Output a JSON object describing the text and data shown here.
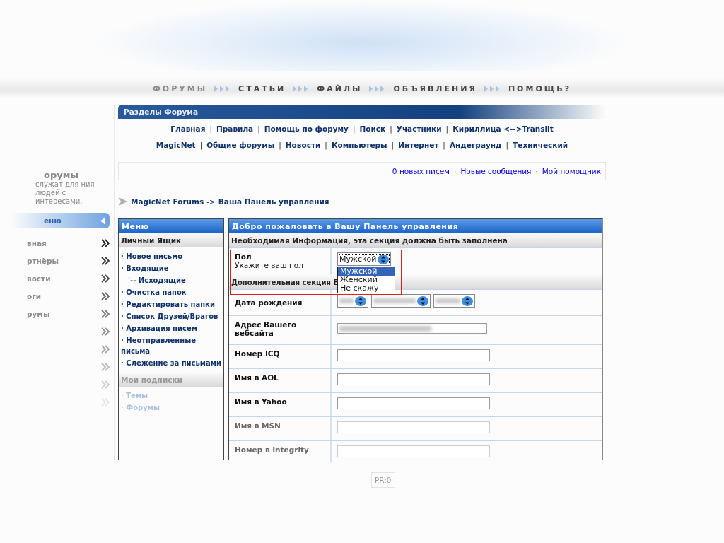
{
  "top_nav": [
    {
      "label": "ФОРУМЫ",
      "faded": true
    },
    {
      "label": "СТАТЬИ",
      "faded": false
    },
    {
      "label": "ФАЙЛЫ",
      "faded": false
    },
    {
      "label": "ОБЪЯВЛЕНИЯ",
      "faded": false
    },
    {
      "label": "ПОМОЩЬ?",
      "faded": false
    }
  ],
  "sidebar": {
    "title": "орумы",
    "description": "служат для ния людей с интересами.",
    "menu_button": "еню",
    "items": [
      {
        "label": "вная"
      },
      {
        "label": "ртнёры"
      },
      {
        "label": "вости"
      },
      {
        "label": "оги"
      },
      {
        "label": "румы"
      }
    ]
  },
  "forum_sections": {
    "title": "Разделы Форума",
    "separator": "|",
    "links_row_1": [
      "Главная",
      "Правила",
      "Помощь по форуму",
      "Поиск",
      "Участники",
      "Кириллица <-->Translit"
    ],
    "links_row_2": [
      "MagicNet",
      "Общие форумы",
      "Новости",
      "Компьютеры",
      "Интернет",
      "Андеграунд",
      "Технический"
    ]
  },
  "notifications": {
    "separator": "·",
    "links": [
      "0 новых писем",
      "Новые сообщения",
      "Мой помощник"
    ]
  },
  "breadcrumb": {
    "root": "MagicNet Forums",
    "separator": "->",
    "current": "Ваша Панель управления"
  },
  "menu": {
    "title": "Меню",
    "bullet": "·",
    "sections": [
      {
        "title": "Личный Ящик",
        "faded": false,
        "items": [
          {
            "label": "Новое письмо"
          },
          {
            "label": "Входящие",
            "children": [
              {
                "prefix": "'--",
                "label": "Исходящие"
              }
            ]
          },
          {
            "label": "Очистка папок"
          },
          {
            "label": "Редактировать папки"
          },
          {
            "label": "Список Друзей/Врагов"
          },
          {
            "label": "Архивация писем"
          },
          {
            "label": "Неотправленные письма"
          },
          {
            "label": "Слежение за письмами"
          }
        ]
      },
      {
        "title": "Мои подписки",
        "faded": true,
        "items": [
          {
            "label": "Темы"
          },
          {
            "label": "Форумы"
          }
        ]
      }
    ]
  },
  "panel": {
    "title": "Добро пожаловать в Вашу Панель управления",
    "required_section": "Необходимая Информация, эта секция должна быть заполнена",
    "gender": {
      "label": "Пол",
      "hint": "Укажите ваш пол",
      "value": "Мужской",
      "expanded": true,
      "options": [
        {
          "label": "Мужской",
          "selected": true
        },
        {
          "label": "Женский",
          "selected": false
        },
        {
          "label": "Не скажу",
          "selected": false
        }
      ]
    },
    "optional_section": "Дополнительная секция В",
    "fields": [
      {
        "label": "Дата рождения",
        "kind": "date",
        "faded": false
      },
      {
        "label": "Адрес Вашего вебсайта",
        "kind": "blurred",
        "faded": false
      },
      {
        "label": "Номер ICQ",
        "kind": "text",
        "faded": false
      },
      {
        "label": "Имя в AOL",
        "kind": "text",
        "faded": false
      },
      {
        "label": "Имя в Yahoo",
        "kind": "text",
        "faded": false
      },
      {
        "label": "Имя в MSN",
        "kind": "text",
        "faded": true
      },
      {
        "label": "Номер в Integrity",
        "kind": "text",
        "faded": true
      }
    ]
  },
  "footer_badge": "PR:0"
}
